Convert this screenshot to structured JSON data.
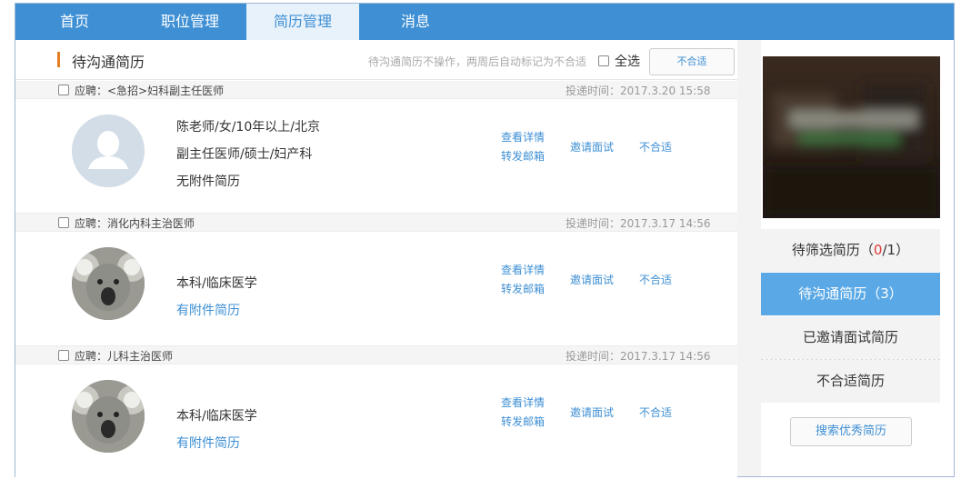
{
  "nav": {
    "items": [
      {
        "label": "首页"
      },
      {
        "label": "职位管理"
      },
      {
        "label": "简历管理"
      },
      {
        "label": "消息"
      }
    ],
    "active_index": 2
  },
  "main": {
    "title": "待沟通简历",
    "hint": "待沟通简历不操作，两周后自动标记为不合适",
    "select_all_label": "全选",
    "reject_all_button": "不合适"
  },
  "cards": [
    {
      "job": "应聘：<急招>妇科副主任医师",
      "time": "投递时间：2017.3.20 15:58",
      "avatar": "default-avatar",
      "line1": "陈老师/女/10年以上/北京",
      "line2": "副主任医师/硕士/妇产科",
      "line3": "无附件简历",
      "view": "查看详情",
      "forward": "转发邮箱",
      "invite": "邀请面试",
      "reject": "不合适"
    },
    {
      "job": "应聘：消化内科主治医师",
      "time": "投递时间：2017.3.17 14:56",
      "avatar": "koala-photo",
      "line2": "本科/临床医学",
      "line3": "有附件简历",
      "view": "查看详情",
      "forward": "转发邮箱",
      "invite": "邀请面试",
      "reject": "不合适"
    },
    {
      "job": "应聘：儿科主治医师",
      "time": "投递时间：2017.3.17 14:56",
      "avatar": "koala-photo",
      "line2": "本科/临床医学",
      "line3": "有附件简历",
      "view": "查看详情",
      "forward": "转发邮箱",
      "invite": "邀请面试",
      "reject": "不合适"
    }
  ],
  "sidebar": {
    "filter": {
      "label": "待筛选简历（",
      "new": "0",
      "rest": "/1）"
    },
    "pending": "待沟通简历（3）",
    "invited": "已邀请面试简历",
    "rejected": "不合适简历",
    "search_button": "搜索优秀简历"
  },
  "colors": {
    "nav_bg": "#3e8fd4",
    "accent": "#3e8fd4",
    "title_mark": "#e67e22",
    "active_side": "#5aa9e6",
    "highlight": "#e23b3b"
  }
}
